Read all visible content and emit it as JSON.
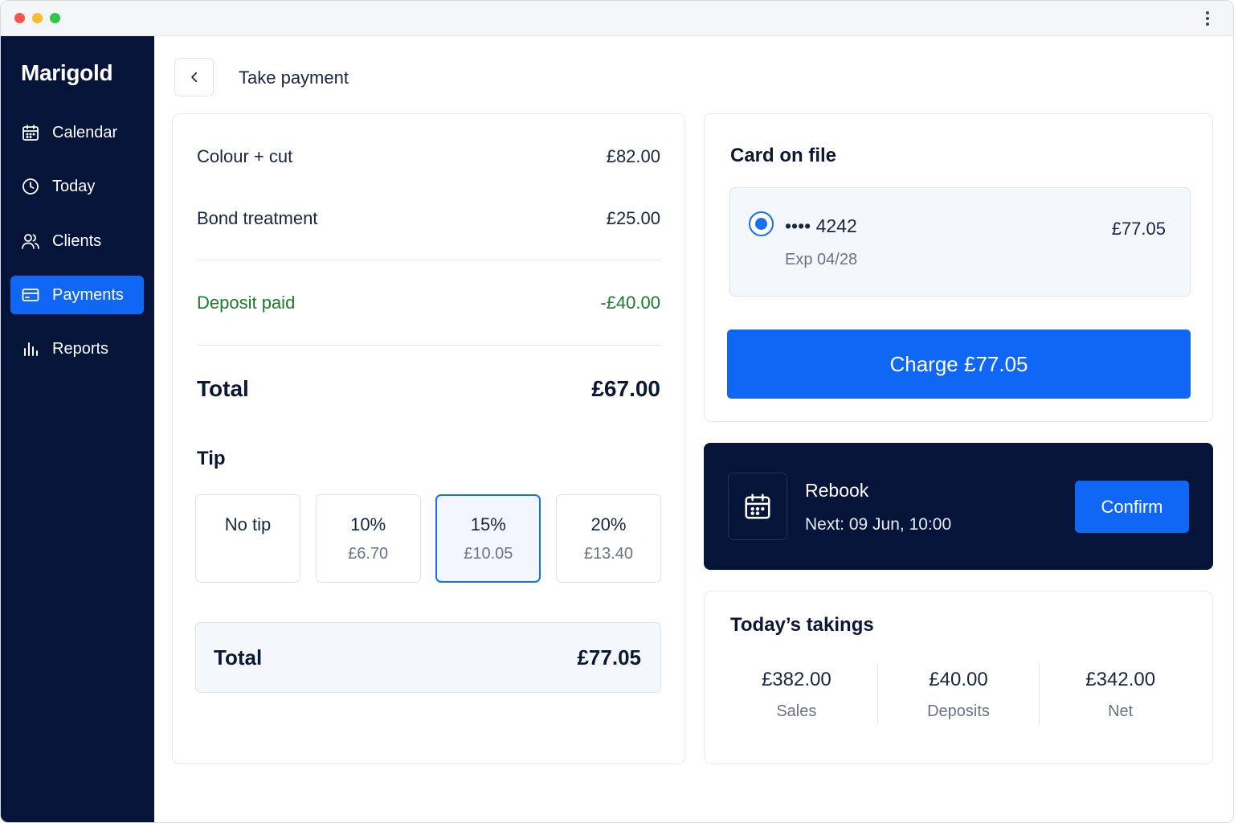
{
  "app": {
    "brand": "Marigold"
  },
  "sidebar": {
    "items": [
      {
        "label": "Calendar",
        "icon": "calendar-icon"
      },
      {
        "label": "Today",
        "icon": "clock-icon"
      },
      {
        "label": "Clients",
        "icon": "users-icon"
      },
      {
        "label": "Payments",
        "icon": "card-icon",
        "active": true
      },
      {
        "label": "Reports",
        "icon": "bar-chart-icon"
      }
    ]
  },
  "header": {
    "title": "Take payment"
  },
  "bill": {
    "lines": [
      {
        "label": "Colour + cut",
        "amount": "£82.00"
      },
      {
        "label": "Bond treatment",
        "amount": "£25.00"
      }
    ],
    "deposit": {
      "label": "Deposit paid",
      "amount": "-£40.00"
    },
    "total": {
      "label": "Total",
      "amount": "£67.00"
    }
  },
  "tip": {
    "heading": "Tip",
    "options": [
      {
        "label": "No tip",
        "amount": ""
      },
      {
        "label": "10%",
        "amount": "£6.70"
      },
      {
        "label": "15%",
        "amount": "£10.05",
        "selected": true
      },
      {
        "label": "20%",
        "amount": "£13.40"
      }
    ]
  },
  "grand_total": {
    "label": "Total",
    "amount": "£77.05"
  },
  "card_on_file": {
    "title": "Card on file",
    "number": "•••• 4242",
    "expiry": "Exp 04/28",
    "amount": "£77.05",
    "charge_label": "Charge £77.05"
  },
  "rebook": {
    "title": "Rebook",
    "next": "Next: 09 Jun, 10:00",
    "confirm_label": "Confirm"
  },
  "takings": {
    "title": "Today’s takings",
    "stats": [
      {
        "value": "£382.00",
        "label": "Sales"
      },
      {
        "value": "£40.00",
        "label": "Deposits"
      },
      {
        "value": "£342.00",
        "label": "Net"
      }
    ]
  },
  "colors": {
    "sidebar_bg": "#06143a",
    "accent": "#1066f5",
    "deposit_green": "#1c7a2b"
  }
}
